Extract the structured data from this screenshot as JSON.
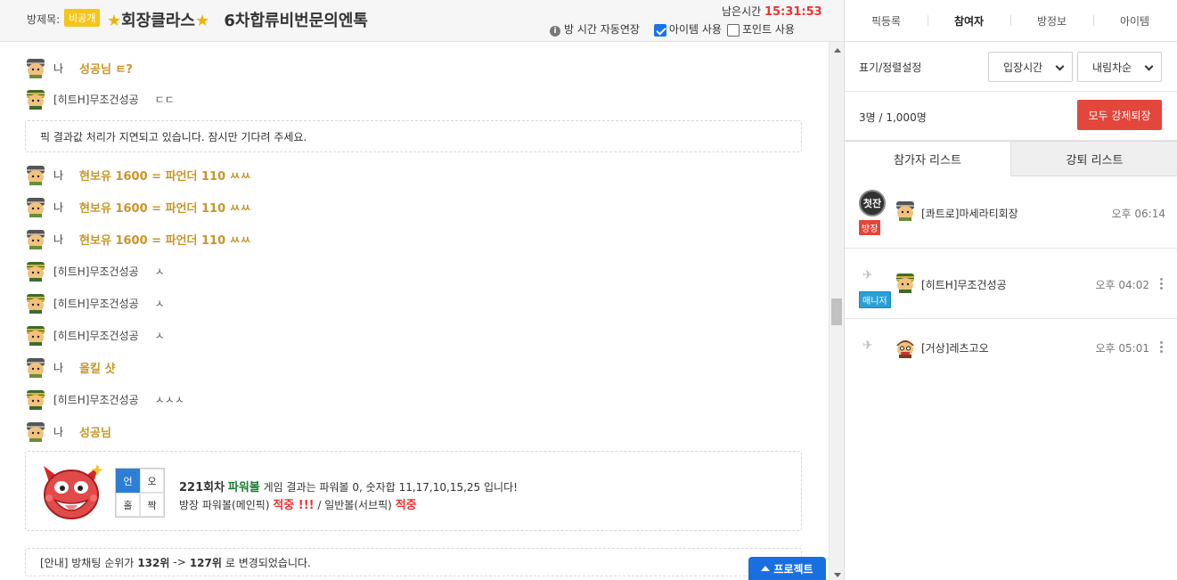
{
  "header": {
    "room_label": "방제목:",
    "private_badge": "비공개",
    "title": "회장클라스",
    "title_suffix": "6차합류비번문의엔톡",
    "remaining_label": "남은시간",
    "remaining_time": "15:31:53",
    "auto_extend": "방 시간 자동연장",
    "use_item": "아이템 사용",
    "use_item_checked": true,
    "use_point": "포인트 사용",
    "use_point_checked": false
  },
  "chat": {
    "rows": [
      {
        "type": "gold",
        "name": "나",
        "text": "성공님 ㅌ?"
      },
      {
        "type": "plain",
        "name": "[히트H]무조건성공",
        "text": "ㄷㄷ"
      },
      {
        "type": "notice",
        "text": "픽 결과값 처리가 지연되고 있습니다. 잠시만 기다려 주세요."
      },
      {
        "type": "gold",
        "name": "나",
        "text": "현보유 1600 = 파언더 110 ㅆㅆ"
      },
      {
        "type": "gold",
        "name": "나",
        "text": "현보유 1600 = 파언더 110 ㅆㅆ"
      },
      {
        "type": "gold",
        "name": "나",
        "text": "현보유 1600 = 파언더 110 ㅆㅆ"
      },
      {
        "type": "plain",
        "name": "[히트H]무조건성공",
        "text": "ㅅ"
      },
      {
        "type": "plain",
        "name": "[히트H]무조건성공",
        "text": "ㅅ"
      },
      {
        "type": "plain",
        "name": "[히트H]무조건성공",
        "text": "ㅅ"
      },
      {
        "type": "gold",
        "name": "나",
        "text": "올킬 샷"
      },
      {
        "type": "plain",
        "name": "[히트H]무조건성공",
        "text": "ㅅㅅㅅ"
      },
      {
        "type": "gold",
        "name": "나",
        "text": "성공님"
      }
    ],
    "result": {
      "grid": [
        "언",
        "오",
        "홀",
        "짝"
      ],
      "round": "221회차",
      "game": "파워볼",
      "line1_rest": "게임 결과는 파워볼 0, 숫자합 11,17,10,15,25 입니다!",
      "line2_a": "방장 파워볼(메인픽)",
      "hit1": "적중 !!!",
      "line2_b": "/ 일반볼(서브픽)",
      "hit2": "적중"
    },
    "rank_notice": {
      "prefix": "[안내] 방채팅 순위가",
      "from": "132위",
      "arrow": "->",
      "to": "127위",
      "suffix": "로 변경되었습니다."
    },
    "protect_button": "프로젝트"
  },
  "panel": {
    "tabs": [
      "픽등록",
      "참여자",
      "방정보",
      "아이템"
    ],
    "active_tab": "참여자",
    "sort_label": "표기/정렬설정",
    "sort_select": "입장시간",
    "order_select": "내림차순",
    "count": "3명 / 1,000명",
    "kick_all": "모두 강제퇴장",
    "subtab_active": "참가자 리스트",
    "subtab_inactive": "강퇴 리스트",
    "members": [
      {
        "name": "[콰트로]마세라티회장",
        "time": "오후 06:14",
        "role": "방장",
        "level_text": "첫잔"
      },
      {
        "name": "[히트H]무조건성공",
        "time": "오후 04:02",
        "role": "매니저"
      },
      {
        "name": "[거상]레츠고오",
        "time": "오후 05:01",
        "role": ""
      }
    ]
  },
  "colors": {
    "gold_text": "#c9962a",
    "accent_red": "#e3463a",
    "accent_blue": "#1a6fe0"
  }
}
